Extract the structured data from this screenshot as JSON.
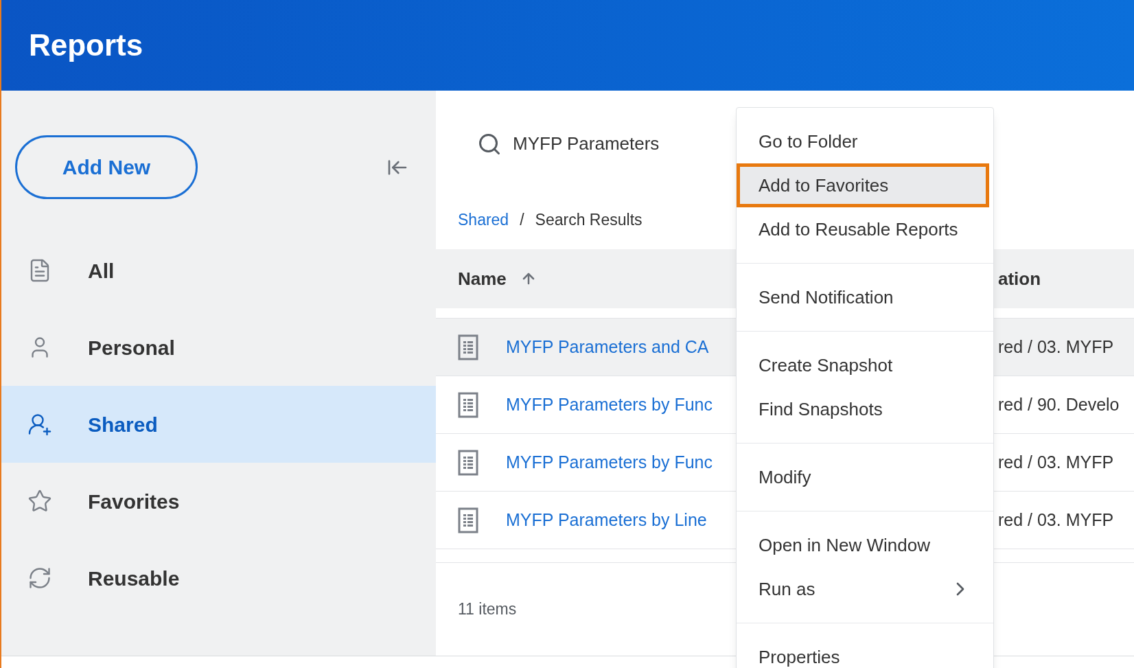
{
  "header": {
    "title": "Reports"
  },
  "sidebar": {
    "add_button": "Add New",
    "items": [
      {
        "label": "All",
        "kind": "all",
        "selected": false
      },
      {
        "label": "Personal",
        "kind": "personal",
        "selected": false
      },
      {
        "label": "Shared",
        "kind": "shared",
        "selected": true
      },
      {
        "label": "Favorites",
        "kind": "favorites",
        "selected": false
      },
      {
        "label": "Reusable",
        "kind": "reusable",
        "selected": false
      }
    ]
  },
  "search": {
    "value": "MYFP Parameters"
  },
  "breadcrumb": [
    {
      "label": "Shared",
      "link": true
    },
    {
      "label": "/",
      "link": false
    },
    {
      "label": "Search Results",
      "link": false
    }
  ],
  "table": {
    "columns": [
      {
        "label": "Name",
        "sorted": true
      },
      {
        "label": "ation",
        "sorted": false
      }
    ],
    "rows": [
      {
        "name": "MYFP Parameters and CA",
        "location": "red / 03. MYFP",
        "hovered": true
      },
      {
        "name": "MYFP Parameters by Func",
        "location": "red / 90. Develo",
        "hovered": false
      },
      {
        "name": "MYFP Parameters by Func",
        "location": "red / 03. MYFP",
        "hovered": false
      },
      {
        "name": "MYFP Parameters by Line",
        "location": "red / 03. MYFP",
        "hovered": false
      }
    ]
  },
  "item_count": "11 items",
  "context_menu": {
    "groups": [
      [
        {
          "label": "Go to Folder",
          "highlighted": false,
          "submenu": false
        },
        {
          "label": "Add to Favorites",
          "highlighted": true,
          "submenu": false
        },
        {
          "label": "Add to Reusable Reports",
          "highlighted": false,
          "submenu": false
        }
      ],
      [
        {
          "label": "Send Notification",
          "highlighted": false,
          "submenu": false
        }
      ],
      [
        {
          "label": "Create Snapshot",
          "highlighted": false,
          "submenu": false
        },
        {
          "label": "Find Snapshots",
          "highlighted": false,
          "submenu": false
        }
      ],
      [
        {
          "label": "Modify",
          "highlighted": false,
          "submenu": false
        }
      ],
      [
        {
          "label": "Open in New Window",
          "highlighted": false,
          "submenu": false
        },
        {
          "label": "Run as",
          "highlighted": false,
          "submenu": true
        }
      ],
      [
        {
          "label": "Properties",
          "highlighted": false,
          "submenu": false
        }
      ]
    ]
  }
}
